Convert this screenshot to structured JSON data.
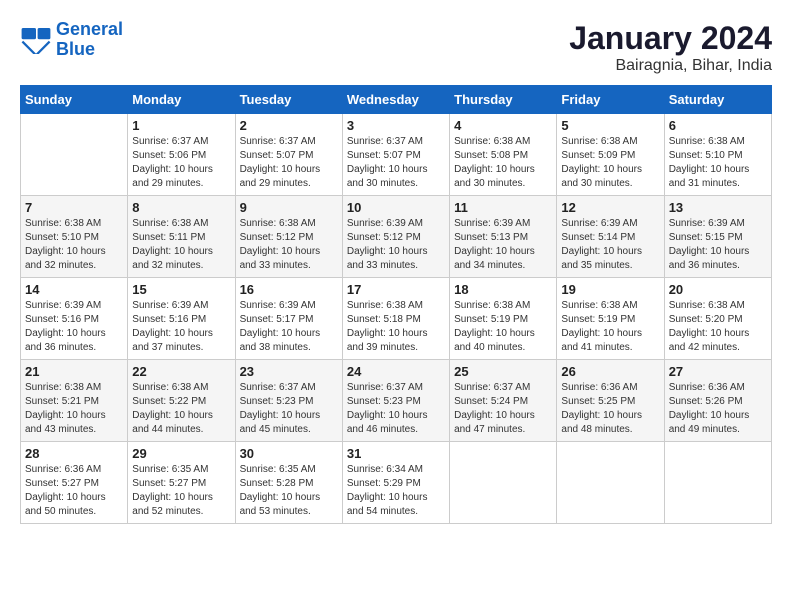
{
  "logo": {
    "line1": "General",
    "line2": "Blue"
  },
  "title": "January 2024",
  "subtitle": "Bairagnia, Bihar, India",
  "headers": [
    "Sunday",
    "Monday",
    "Tuesday",
    "Wednesday",
    "Thursday",
    "Friday",
    "Saturday"
  ],
  "weeks": [
    [
      {
        "day": "",
        "info": ""
      },
      {
        "day": "1",
        "info": "Sunrise: 6:37 AM\nSunset: 5:06 PM\nDaylight: 10 hours\nand 29 minutes."
      },
      {
        "day": "2",
        "info": "Sunrise: 6:37 AM\nSunset: 5:07 PM\nDaylight: 10 hours\nand 29 minutes."
      },
      {
        "day": "3",
        "info": "Sunrise: 6:37 AM\nSunset: 5:07 PM\nDaylight: 10 hours\nand 30 minutes."
      },
      {
        "day": "4",
        "info": "Sunrise: 6:38 AM\nSunset: 5:08 PM\nDaylight: 10 hours\nand 30 minutes."
      },
      {
        "day": "5",
        "info": "Sunrise: 6:38 AM\nSunset: 5:09 PM\nDaylight: 10 hours\nand 30 minutes."
      },
      {
        "day": "6",
        "info": "Sunrise: 6:38 AM\nSunset: 5:10 PM\nDaylight: 10 hours\nand 31 minutes."
      }
    ],
    [
      {
        "day": "7",
        "info": "Sunrise: 6:38 AM\nSunset: 5:10 PM\nDaylight: 10 hours\nand 32 minutes."
      },
      {
        "day": "8",
        "info": "Sunrise: 6:38 AM\nSunset: 5:11 PM\nDaylight: 10 hours\nand 32 minutes."
      },
      {
        "day": "9",
        "info": "Sunrise: 6:38 AM\nSunset: 5:12 PM\nDaylight: 10 hours\nand 33 minutes."
      },
      {
        "day": "10",
        "info": "Sunrise: 6:39 AM\nSunset: 5:12 PM\nDaylight: 10 hours\nand 33 minutes."
      },
      {
        "day": "11",
        "info": "Sunrise: 6:39 AM\nSunset: 5:13 PM\nDaylight: 10 hours\nand 34 minutes."
      },
      {
        "day": "12",
        "info": "Sunrise: 6:39 AM\nSunset: 5:14 PM\nDaylight: 10 hours\nand 35 minutes."
      },
      {
        "day": "13",
        "info": "Sunrise: 6:39 AM\nSunset: 5:15 PM\nDaylight: 10 hours\nand 36 minutes."
      }
    ],
    [
      {
        "day": "14",
        "info": "Sunrise: 6:39 AM\nSunset: 5:16 PM\nDaylight: 10 hours\nand 36 minutes."
      },
      {
        "day": "15",
        "info": "Sunrise: 6:39 AM\nSunset: 5:16 PM\nDaylight: 10 hours\nand 37 minutes."
      },
      {
        "day": "16",
        "info": "Sunrise: 6:39 AM\nSunset: 5:17 PM\nDaylight: 10 hours\nand 38 minutes."
      },
      {
        "day": "17",
        "info": "Sunrise: 6:38 AM\nSunset: 5:18 PM\nDaylight: 10 hours\nand 39 minutes."
      },
      {
        "day": "18",
        "info": "Sunrise: 6:38 AM\nSunset: 5:19 PM\nDaylight: 10 hours\nand 40 minutes."
      },
      {
        "day": "19",
        "info": "Sunrise: 6:38 AM\nSunset: 5:19 PM\nDaylight: 10 hours\nand 41 minutes."
      },
      {
        "day": "20",
        "info": "Sunrise: 6:38 AM\nSunset: 5:20 PM\nDaylight: 10 hours\nand 42 minutes."
      }
    ],
    [
      {
        "day": "21",
        "info": "Sunrise: 6:38 AM\nSunset: 5:21 PM\nDaylight: 10 hours\nand 43 minutes."
      },
      {
        "day": "22",
        "info": "Sunrise: 6:38 AM\nSunset: 5:22 PM\nDaylight: 10 hours\nand 44 minutes."
      },
      {
        "day": "23",
        "info": "Sunrise: 6:37 AM\nSunset: 5:23 PM\nDaylight: 10 hours\nand 45 minutes."
      },
      {
        "day": "24",
        "info": "Sunrise: 6:37 AM\nSunset: 5:23 PM\nDaylight: 10 hours\nand 46 minutes."
      },
      {
        "day": "25",
        "info": "Sunrise: 6:37 AM\nSunset: 5:24 PM\nDaylight: 10 hours\nand 47 minutes."
      },
      {
        "day": "26",
        "info": "Sunrise: 6:36 AM\nSunset: 5:25 PM\nDaylight: 10 hours\nand 48 minutes."
      },
      {
        "day": "27",
        "info": "Sunrise: 6:36 AM\nSunset: 5:26 PM\nDaylight: 10 hours\nand 49 minutes."
      }
    ],
    [
      {
        "day": "28",
        "info": "Sunrise: 6:36 AM\nSunset: 5:27 PM\nDaylight: 10 hours\nand 50 minutes."
      },
      {
        "day": "29",
        "info": "Sunrise: 6:35 AM\nSunset: 5:27 PM\nDaylight: 10 hours\nand 52 minutes."
      },
      {
        "day": "30",
        "info": "Sunrise: 6:35 AM\nSunset: 5:28 PM\nDaylight: 10 hours\nand 53 minutes."
      },
      {
        "day": "31",
        "info": "Sunrise: 6:34 AM\nSunset: 5:29 PM\nDaylight: 10 hours\nand 54 minutes."
      },
      {
        "day": "",
        "info": ""
      },
      {
        "day": "",
        "info": ""
      },
      {
        "day": "",
        "info": ""
      }
    ]
  ]
}
